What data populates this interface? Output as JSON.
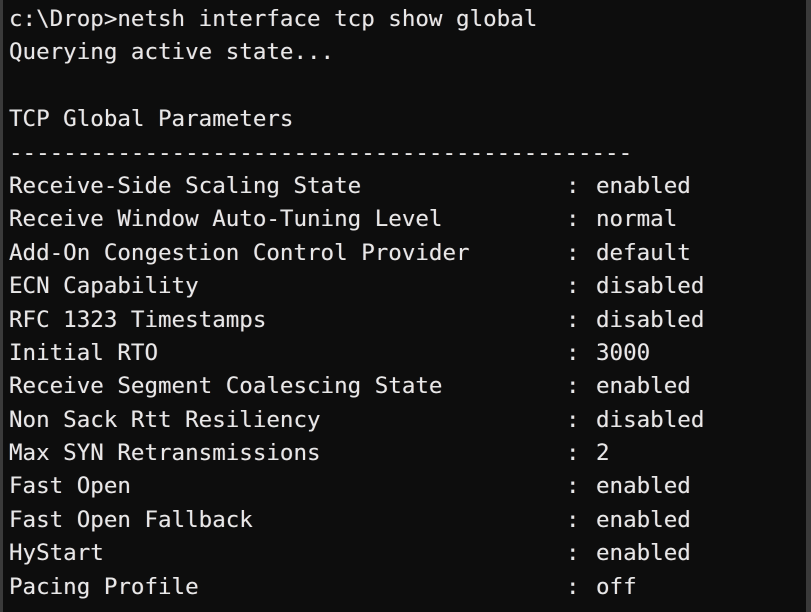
{
  "terminal": {
    "background_color": "#0d0d0d",
    "text_color": "#e8e8e8",
    "border_color": "#3a3a3a",
    "prompt_line": "c:\\Drop>netsh interface tcp show global",
    "status_line": "Querying active state...",
    "blank_line": " ",
    "section_title": "TCP Global Parameters",
    "separator": "----------------------------------------------",
    "separator_char": "-",
    "separator_length": 46,
    "value_separator": ":",
    "parameters": [
      {
        "name": "Receive-Side Scaling State",
        "value": "enabled"
      },
      {
        "name": "Receive Window Auto-Tuning Level",
        "value": "normal"
      },
      {
        "name": "Add-On Congestion Control Provider",
        "value": "default"
      },
      {
        "name": "ECN Capability",
        "value": "disabled"
      },
      {
        "name": "RFC 1323 Timestamps",
        "value": "disabled"
      },
      {
        "name": "Initial RTO",
        "value": "3000"
      },
      {
        "name": "Receive Segment Coalescing State",
        "value": "enabled"
      },
      {
        "name": "Non Sack Rtt Resiliency",
        "value": "disabled"
      },
      {
        "name": "Max SYN Retransmissions",
        "value": "2"
      },
      {
        "name": "Fast Open",
        "value": "enabled"
      },
      {
        "name": "Fast Open Fallback",
        "value": "enabled"
      },
      {
        "name": "HyStart",
        "value": "enabled"
      },
      {
        "name": "Pacing Profile",
        "value": "off"
      }
    ]
  }
}
